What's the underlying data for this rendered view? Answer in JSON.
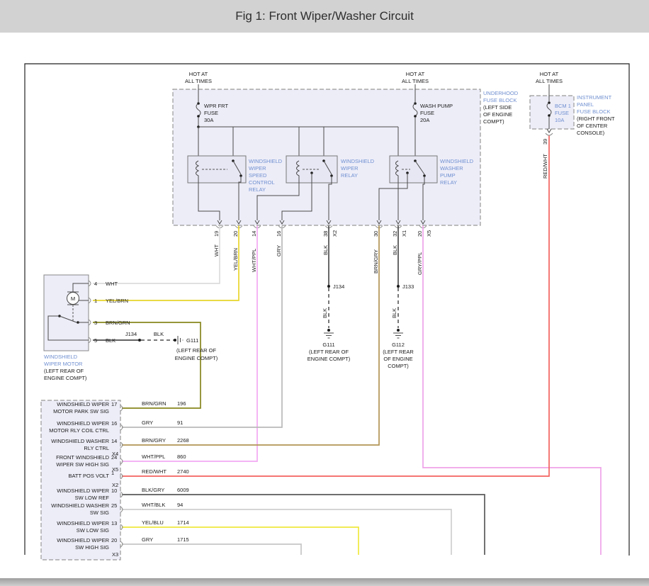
{
  "header": {
    "title": "Fig 1: Front Wiper/Washer Circuit"
  },
  "colors": {
    "header_bg": "#d2d2d2",
    "label_blue": "#6f8fd0",
    "box_fill": "#ededf8",
    "line": "#4a4a4a",
    "wht": "#dcdcdc",
    "yel_brn": "#e8d52c",
    "wht_ppl": "#f2aaf2",
    "gry": "#b9b9b9",
    "blk": "#4d4d4d",
    "brn_gry": "#b29556",
    "gry_ppl": "#efa2e9",
    "red_wht": "#f2635f",
    "brn_grn": "#87871f",
    "blk_gry": "#5a5a5a",
    "wht_blk": "#cfcfcf",
    "yel_blu": "#efe93e",
    "gry2": "#c6c6c6"
  },
  "power": {
    "hot1": {
      "l1": "HOT AT",
      "l2": "ALL TIMES"
    },
    "hot2": {
      "l1": "HOT AT",
      "l2": "ALL TIMES"
    },
    "hot3": {
      "l1": "HOT AT",
      "l2": "ALL TIMES"
    },
    "fuse1": {
      "l1": "WPR FRT",
      "l2": "FUSE",
      "l3": "30A"
    },
    "fuse2": {
      "l1": "WASH PUMP",
      "l2": "FUSE",
      "l3": "20A"
    },
    "fuse3": {
      "l1": "BCM 1",
      "l2": "FUSE",
      "l3": "10A"
    }
  },
  "underhood_label": {
    "l1": "UNDERHOOD",
    "l2": "FUSE BLOCK",
    "l3": "(LEFT SIDE",
    "l4": "OF ENGINE",
    "l5": "COMPT)"
  },
  "instrument_label": {
    "l1": "INSTRUMENT",
    "l2": "PANEL",
    "l3": "FUSE BLOCK",
    "l4": "(RIGHT FRONT",
    "l5": "OF CENTER",
    "l6": "CONSOLE)"
  },
  "relays": {
    "r1": {
      "l1": "WINDSHIELD",
      "l2": "WIPER",
      "l3": "SPEED",
      "l4": "CONTROL",
      "l5": "RELAY"
    },
    "r2": {
      "l1": "WINDSHIELD",
      "l2": "WIPER",
      "l3": "RELAY"
    },
    "r3": {
      "l1": "WINDSHIELD",
      "l2": "WASHER",
      "l3": "PUMP",
      "l4": "RELAY"
    }
  },
  "fb_pins": {
    "p19": {
      "pin": "19",
      "wire": "WHT"
    },
    "p20": {
      "pin": "20",
      "wire": "YEL/BRN"
    },
    "p14": {
      "pin": "14",
      "wire": "WHT/PPL"
    },
    "p16": {
      "pin": "16",
      "wire": "GRY"
    },
    "p38": {
      "pin": "38",
      "conn": "X2",
      "wire": "BLK"
    },
    "p30": {
      "pin": "30",
      "wire": "BRN/GRY"
    },
    "p32": {
      "pin": "32",
      "conn": "X1",
      "wire": "BLK"
    },
    "p20b": {
      "pin": "20",
      "conn": "X5",
      "wire": "GRY/PPL"
    }
  },
  "ip_pin": {
    "pin": "39",
    "wire": "RED/WHT"
  },
  "motor": {
    "m": "M",
    "label": {
      "l1": "WINDSHIELD",
      "l2": "WIPER MOTOR",
      "l3": "(LEFT REAR OF",
      "l4": "ENGINE COMPT)"
    },
    "pins": {
      "p4": {
        "pin": "4",
        "wire": "WHT"
      },
      "p1": {
        "pin": "1",
        "wire": "YEL/BRN"
      },
      "p3": {
        "pin": "3",
        "wire": "BRN/GRN"
      },
      "p5": {
        "pin": "5",
        "wire": "BLK"
      }
    },
    "ground": {
      "splice": "J134",
      "wire": "BLK",
      "name": "G111",
      "l1": "(LEFT REAR OF",
      "l2": "ENGINE COMPT)"
    }
  },
  "grounds": {
    "g111": {
      "splice": "J134",
      "wire": "BLK",
      "name": "G111",
      "l1": "(LEFT REAR OF",
      "l2": "ENGINE COMPT)"
    },
    "g112": {
      "splice": "J133",
      "wire": "BLK",
      "name": "G112",
      "l1": "(LEFT REAR",
      "l2": "OF ENGINE",
      "l3": "COMPT)"
    }
  },
  "bcm": {
    "rows": [
      {
        "l1": "WINDSHIELD WIPER",
        "l2": "MOTOR PARK SW SIG",
        "pin": "17",
        "wire": "BRN/GRN",
        "ckt": "196"
      },
      {
        "l1": "WINDSHIELD WIPER",
        "l2": "MOTOR RLY COIL CTRL",
        "pin": "16",
        "wire": "GRY",
        "ckt": "91"
      },
      {
        "l1": "WINDSHIELD WASHER",
        "l2": "RLY CTRL",
        "pin": "14",
        "wire": "BRN/GRY",
        "ckt": "2268"
      },
      {
        "l1": "FRONT WINDSHIELD",
        "l2": "WIPER SW HIGH SIG",
        "pin": "24",
        "wire": "WHT/PPL",
        "ckt": "860"
      },
      {
        "l1": "BATT POS VOLT",
        "l2": "",
        "pin": "1",
        "wire": "RED/WHT",
        "ckt": "2740"
      },
      {
        "l1": "WINDSHIELD WIPER",
        "l2": "SW LOW REF",
        "pin": "10",
        "wire": "BLK/GRY",
        "ckt": "6009"
      },
      {
        "l1": "WINDSHIELD WASHER",
        "l2": "SW SIG",
        "pin": "25",
        "wire": "WHT/BLK",
        "ckt": "94"
      },
      {
        "l1": "WINDSHIELD WIPER",
        "l2": "SW LOW SIG",
        "pin": "13",
        "wire": "YEL/BLU",
        "ckt": "1714"
      },
      {
        "l1": "WINDSHIELD WIPER",
        "l2": "SW HIGH SIG",
        "pin": "20",
        "wire": "GRY",
        "ckt": "1715"
      }
    ],
    "connectors": {
      "x4": "X4",
      "x5": "X5",
      "x2": "X2",
      "x3": "X3"
    }
  }
}
